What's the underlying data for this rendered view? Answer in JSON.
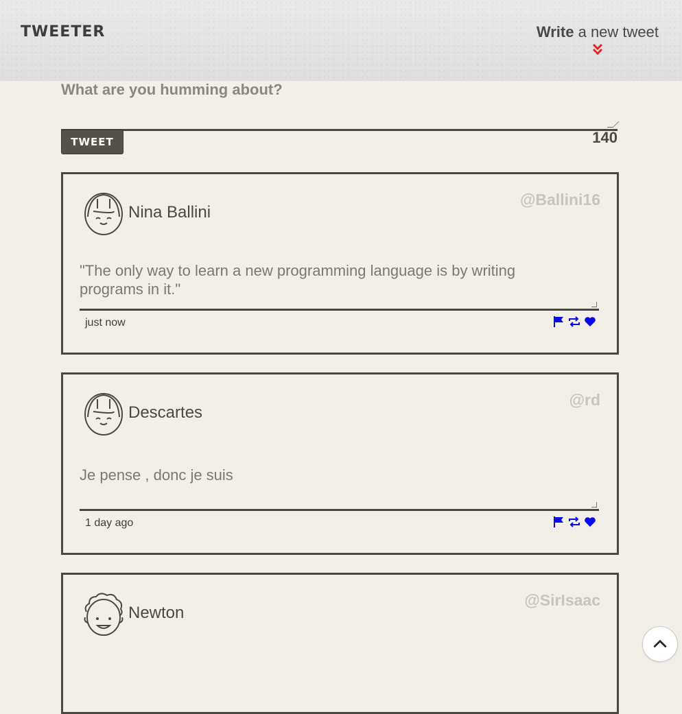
{
  "header": {
    "logo": "TWEETER",
    "compose_bold": "Write",
    "compose_rest": " a new tweet"
  },
  "compose": {
    "prompt": "What are you humming about?",
    "button_label": "TWEET",
    "char_count": "140"
  },
  "tweets": [
    {
      "author": "Nina Ballini",
      "handle": "@Ballini16",
      "text": "\"The only way to learn a new programming language is by writing programs in it.\"",
      "time": "just now"
    },
    {
      "author": "Descartes",
      "handle": "@rd",
      "text": "Je pense , donc je suis",
      "time": "1 day ago"
    },
    {
      "author": "Newton",
      "handle": "@SirIsaac",
      "text": "",
      "time": ""
    }
  ],
  "colors": {
    "accent_red": "#e0262b",
    "action_blue": "#0a0ae8",
    "text_dark": "#4a4843"
  }
}
